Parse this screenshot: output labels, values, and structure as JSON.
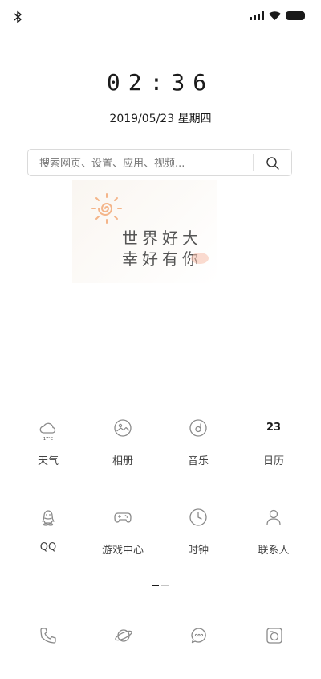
{
  "status_bar": {
    "left_icon": "bluetooth-icon",
    "right_icons": [
      "signal-icon",
      "wifi-icon",
      "battery-icon"
    ]
  },
  "clock": {
    "time": "02:36",
    "date": "2019/05/23 星期四"
  },
  "search": {
    "placeholder": "搜索网页、设置、应用、视频...",
    "button_icon": "search-icon"
  },
  "widget": {
    "line1": "世界好大",
    "line2": "幸好有你",
    "decoration_icon": "sun-icon"
  },
  "apps": [
    {
      "label": "天气",
      "icon": "weather-icon",
      "sub": "17°C"
    },
    {
      "label": "相册",
      "icon": "gallery-icon"
    },
    {
      "label": "音乐",
      "icon": "music-icon"
    },
    {
      "label": "日历",
      "icon": "calendar-icon",
      "day": "23"
    },
    {
      "label": "QQ",
      "icon": "qq-icon"
    },
    {
      "label": "游戏中心",
      "icon": "gamepad-icon"
    },
    {
      "label": "时钟",
      "icon": "clock-icon"
    },
    {
      "label": "联系人",
      "icon": "contacts-icon"
    }
  ],
  "page_indicator": {
    "current": 1,
    "total": 2
  },
  "dock": [
    {
      "icon": "phone-icon"
    },
    {
      "icon": "browser-icon"
    },
    {
      "icon": "messages-icon"
    },
    {
      "icon": "camera-icon"
    }
  ],
  "colors": {
    "text_primary": "#1b1b1b",
    "icon_gray": "#8a8a8a",
    "sun_orange": "#f4b58a"
  }
}
